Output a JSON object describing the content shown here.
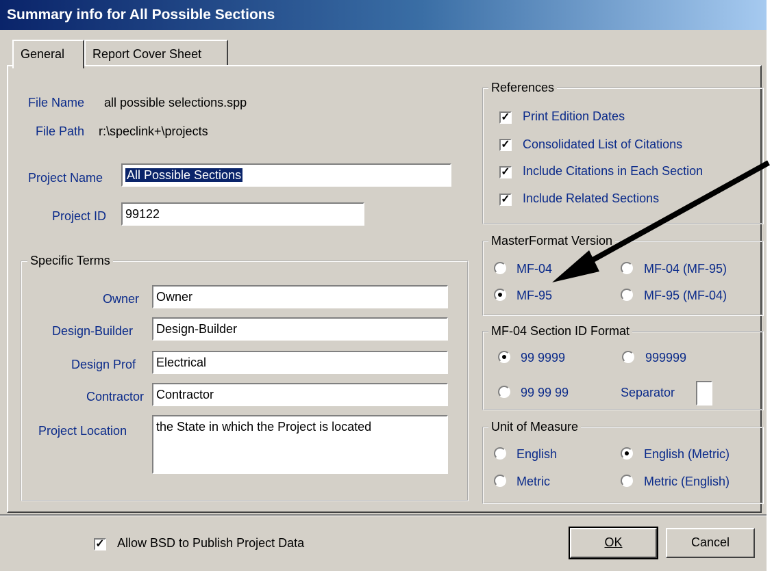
{
  "window": {
    "title": "Summary info for All Possible Sections"
  },
  "tabs": [
    {
      "label": "General"
    },
    {
      "label": "Report Cover Sheet"
    }
  ],
  "general": {
    "file_name_label": "File Name",
    "file_name": "all possible selections.spp",
    "file_path_label": "File Path",
    "file_path": "r:\\speclink+\\projects",
    "project_name_label": "Project Name",
    "project_name": "All Possible Sections",
    "project_id_label": "Project ID",
    "project_id": "99122"
  },
  "specific_terms": {
    "title": "Specific Terms",
    "owner_label": "Owner",
    "owner": "Owner",
    "design_builder_label": "Design-Builder",
    "design_builder": "Design-Builder",
    "design_prof_label": "Design Prof",
    "design_prof": "Electrical",
    "contractor_label": "Contractor",
    "contractor": "Contractor",
    "project_location_label": "Project Location",
    "project_location": "the State in which the Project is located"
  },
  "references": {
    "title": "References",
    "items": [
      {
        "label": "Print Edition Dates",
        "checked": true
      },
      {
        "label": "Consolidated List of Citations",
        "checked": true
      },
      {
        "label": "Include Citations in Each Section",
        "checked": true
      },
      {
        "label": "Include Related Sections",
        "checked": true
      }
    ]
  },
  "masterformat": {
    "title": "MasterFormat Version",
    "options": [
      "MF-04",
      "MF-04 (MF-95)",
      "MF-95",
      "MF-95 (MF-04)"
    ],
    "selected": "MF-95"
  },
  "section_id": {
    "title": "MF-04 Section ID Format",
    "options": [
      "99 9999",
      "999999",
      "99 99 99"
    ],
    "selected": "99 9999",
    "separator_label": "Separator",
    "separator": ""
  },
  "units": {
    "title": "Unit of Measure",
    "options": [
      "English",
      "English (Metric)",
      "Metric",
      "Metric (English)"
    ],
    "selected": "English (Metric)"
  },
  "footer": {
    "allow_publish_label": "Allow BSD to Publish Project Data",
    "allow_publish": true,
    "ok_label": "OK",
    "cancel_label": "Cancel"
  },
  "colors": {
    "label_blue": "#0a2a8a",
    "title_start": "#0a246a",
    "face": "#d4d0c8"
  }
}
